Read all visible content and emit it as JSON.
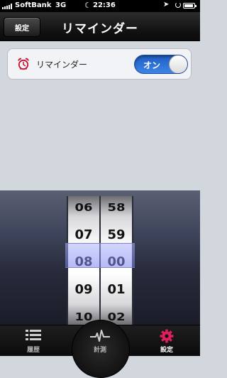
{
  "status_bar": {
    "carrier": "SoftBank",
    "network": "3G",
    "time": "22:36"
  },
  "nav": {
    "back_label": "設定",
    "title": "リマインダー"
  },
  "reminder": {
    "label": "リマインダー",
    "toggle_label": "オン",
    "toggle_on": true,
    "icon": "alarm-clock-icon",
    "icon_color": "#c8102e"
  },
  "picker": {
    "hours": [
      "06",
      "07",
      "08",
      "09",
      "10"
    ],
    "minutes": [
      "58",
      "59",
      "00",
      "01",
      "02"
    ],
    "selected_hour": "08",
    "selected_minute": "00"
  },
  "tabs": [
    {
      "label": "履歴",
      "icon": "list-icon",
      "active": false
    },
    {
      "label": "計測",
      "icon": "pulse-icon",
      "active": false
    },
    {
      "label": "設定",
      "icon": "gear-icon",
      "active": true,
      "color": "#e01f5c"
    }
  ],
  "colors": {
    "toggle_on": "#2a6fd8",
    "accent": "#e01f5c"
  }
}
